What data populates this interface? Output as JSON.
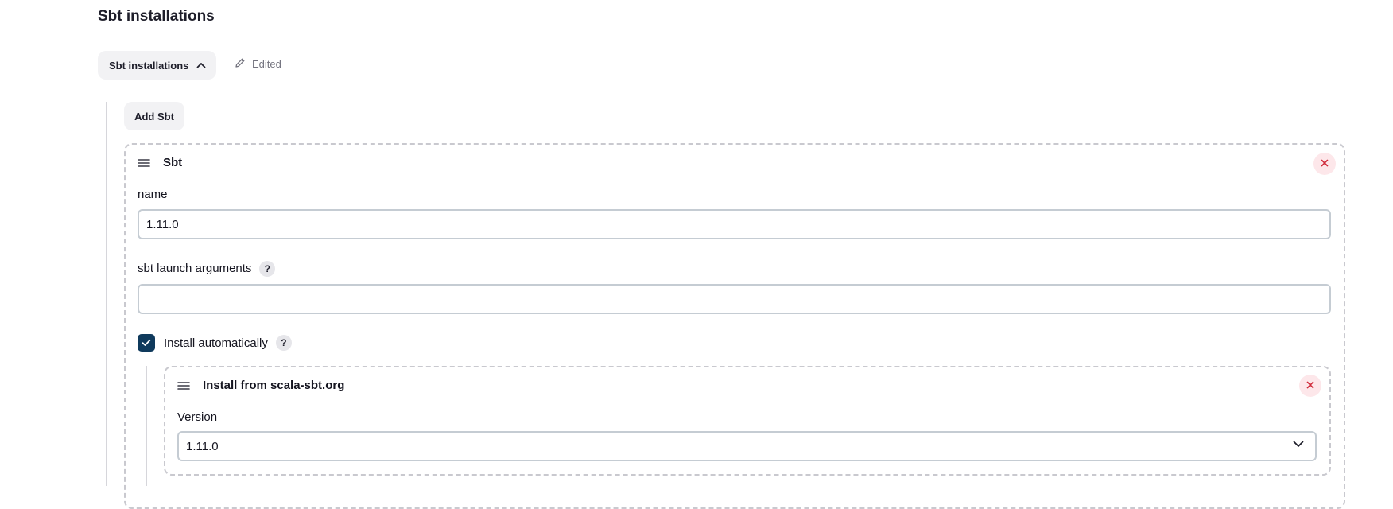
{
  "section": {
    "title": "Sbt installations",
    "toggle_label": "Sbt installations",
    "edited_label": "Edited"
  },
  "add_button_label": "Add Sbt",
  "installation": {
    "title": "Sbt",
    "name_label": "name",
    "name_value": "1.11.0",
    "args_label": "sbt launch arguments",
    "args_value": "",
    "help_glyph": "?",
    "install_auto_label": "Install automatically",
    "install_auto_checked": true,
    "installer": {
      "title": "Install from scala-sbt.org",
      "version_label": "Version",
      "version_value": "1.11.0"
    }
  },
  "colors": {
    "accent_checkbox": "#0f3a5c",
    "close_bg": "#fde7ea",
    "close_fg": "#d02a3a"
  },
  "icons": {
    "toggle": "chevron-up-icon",
    "edited": "pencil-icon",
    "drag": "drag-handle-icon",
    "remove": "close-icon",
    "check": "check-icon",
    "select": "chevron-down-icon"
  }
}
